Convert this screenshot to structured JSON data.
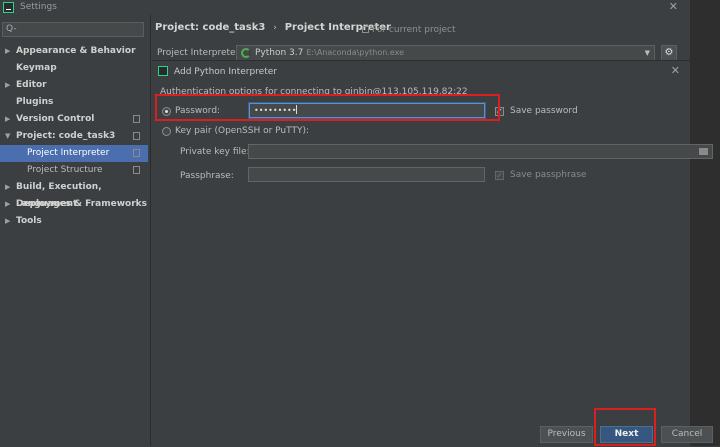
{
  "window": {
    "title": "Settings",
    "close_glyph": "✕"
  },
  "search": {
    "placeholder": "Q-",
    "icon": "search-icon"
  },
  "sidebar": {
    "items": [
      {
        "label": "Appearance & Behavior",
        "arrow": "▶"
      },
      {
        "label": "Keymap"
      },
      {
        "label": "Editor",
        "arrow": "▶"
      },
      {
        "label": "Plugins"
      },
      {
        "label": "Version Control",
        "arrow": "▶"
      },
      {
        "label": "Project: code_task3",
        "arrow": "▼"
      },
      {
        "label": "Project Interpreter",
        "selected": true
      },
      {
        "label": "Project Structure"
      },
      {
        "label": "Build, Execution, Deployment",
        "arrow": "▶"
      },
      {
        "label": "Languages & Frameworks",
        "arrow": "▶"
      },
      {
        "label": "Tools",
        "arrow": "▶"
      }
    ]
  },
  "header": {
    "project": "Project: code_task3",
    "separator": "›",
    "page": "Project Interpreter",
    "for_current_project": "For current project"
  },
  "interpreter": {
    "label": "Project Interpreter:",
    "name": "Python 3.7",
    "path": "E:\\Anaconda\\python.exe",
    "dropdown_glyph": "▼",
    "gear_glyph": "⚙"
  },
  "dialog": {
    "title": "Add Python Interpreter",
    "close_glyph": "✕",
    "auth_text": "Authentication options for connecting to qinbin@113.105.119.82:22",
    "password_label": "Password:",
    "password_value": "•••••••••",
    "save_password": "Save password",
    "keypair_label": "Key pair (OpenSSH or PuTTY):",
    "private_key_label": "Private key file:",
    "passphrase_label": "Passphrase:",
    "save_passphrase": "Save passphrase",
    "check_glyph": "✓"
  },
  "buttons": {
    "previous": "Previous",
    "next": "Next",
    "cancel": "Cancel"
  },
  "colors": {
    "accent": "#4b6eaf",
    "highlight": "#d92020",
    "background": "#3c3f41"
  }
}
